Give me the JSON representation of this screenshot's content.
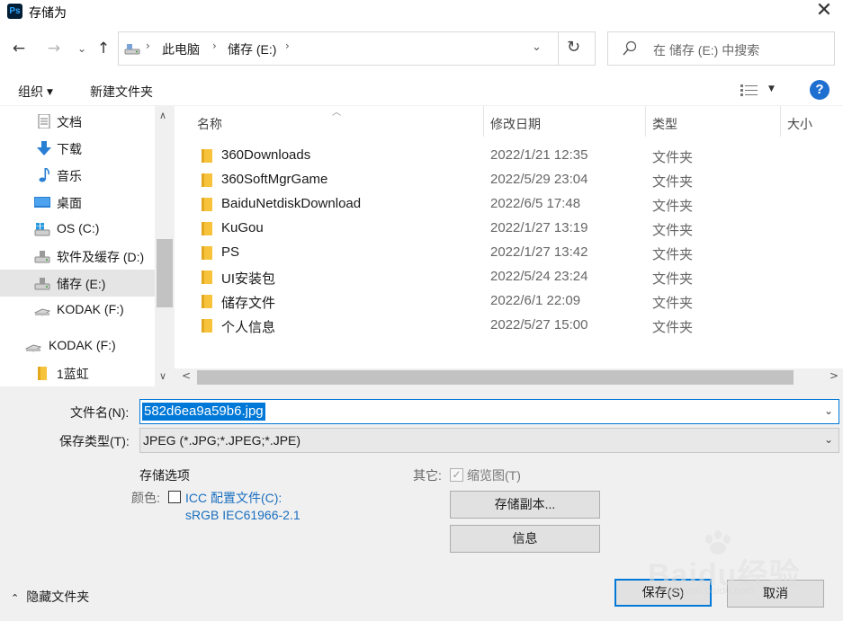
{
  "window": {
    "title": "存储为",
    "app_logo": "Ps"
  },
  "nav": {
    "crumbs": [
      "此电脑",
      "储存 (E:)"
    ],
    "search_placeholder": "在 储存 (E:) 中搜索"
  },
  "toolbar": {
    "organize": "组织",
    "new_folder": "新建文件夹"
  },
  "sidebar": {
    "items": [
      {
        "label": "文档",
        "icon": "document-icon"
      },
      {
        "label": "下载",
        "icon": "download-icon"
      },
      {
        "label": "音乐",
        "icon": "music-icon"
      },
      {
        "label": "桌面",
        "icon": "desktop-icon"
      },
      {
        "label": "OS (C:)",
        "icon": "windows-drive-icon"
      },
      {
        "label": "软件及缓存 (D:)",
        "icon": "drive-icon"
      },
      {
        "label": "储存 (E:)",
        "icon": "drive-icon",
        "selected": true
      },
      {
        "label": "KODAK (F:)",
        "icon": "usb-drive-icon"
      },
      {
        "label": "KODAK (F:)",
        "icon": "usb-drive-icon"
      },
      {
        "label": "1蓝虹",
        "icon": "folder-icon"
      }
    ]
  },
  "filelist": {
    "columns": {
      "name": "名称",
      "date": "修改日期",
      "type": "类型",
      "size": "大小"
    },
    "rows": [
      {
        "name": "360Downloads",
        "date": "2022/1/21 12:35",
        "type": "文件夹"
      },
      {
        "name": "360SoftMgrGame",
        "date": "2022/5/29 23:04",
        "type": "文件夹"
      },
      {
        "name": "BaiduNetdiskDownload",
        "date": "2022/6/5 17:48",
        "type": "文件夹"
      },
      {
        "name": "KuGou",
        "date": "2022/1/27 13:19",
        "type": "文件夹"
      },
      {
        "name": "PS",
        "date": "2022/1/27 13:42",
        "type": "文件夹"
      },
      {
        "name": "UI安装包",
        "date": "2022/5/24 23:24",
        "type": "文件夹"
      },
      {
        "name": "储存文件",
        "date": "2022/6/1 22:09",
        "type": "文件夹"
      },
      {
        "name": "个人信息",
        "date": "2022/5/27 15:00",
        "type": "文件夹"
      }
    ]
  },
  "save": {
    "filename_label": "文件名(N):",
    "filename_value": "582d6ea9a59b6.jpg",
    "type_label": "保存类型(T):",
    "type_value": "JPEG (*.JPG;*.JPEG;*.JPE)",
    "options_title": "存储选项",
    "color_label": "颜色:",
    "icc_label": "ICC 配置文件(C):",
    "icc_profile": "sRGB IEC61966-2.1",
    "other_label": "其它:",
    "thumbnail_label": "缩览图(T)",
    "thumbnail_checked": true,
    "save_copy": "存储副本...",
    "info": "信息",
    "save": "保存(S)",
    "cancel": "取消",
    "hide_folders": "隐藏文件夹"
  },
  "watermark": {
    "brand": "Baidu经验",
    "url": "jingyan.baidu.com"
  },
  "colors": {
    "accent": "#0078d7",
    "link": "#1a6fbf",
    "selection": "#e5e5e5",
    "folder": "#f8c33c"
  }
}
